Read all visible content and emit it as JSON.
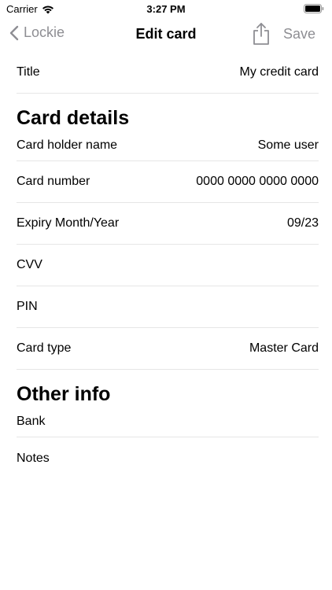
{
  "status": {
    "carrier": "Carrier",
    "time": "3:27 PM"
  },
  "nav": {
    "back_label": "Lockie",
    "title": "Edit card",
    "save_label": "Save"
  },
  "fields": {
    "title": {
      "label": "Title",
      "value": "My credit card"
    }
  },
  "card_details": {
    "header": "Card details",
    "rows": [
      {
        "label": "Card holder name",
        "value": "Some user"
      },
      {
        "label": "Card number",
        "value": "0000 0000 0000 0000"
      },
      {
        "label": "Expiry Month/Year",
        "value": "09/23"
      },
      {
        "label": "CVV",
        "value": ""
      },
      {
        "label": "PIN",
        "value": ""
      },
      {
        "label": "Card type",
        "value": "Master Card"
      }
    ]
  },
  "other_info": {
    "header": "Other info",
    "rows": [
      {
        "label": "Bank",
        "value": ""
      },
      {
        "label": "Notes",
        "value": ""
      }
    ]
  },
  "icons": {
    "wifi": "wifi-icon",
    "battery": "battery-icon",
    "back": "chevron-left-icon",
    "share": "share-icon"
  },
  "colors": {
    "secondary": "#8e8e93",
    "separator": "#e6e6e6"
  }
}
